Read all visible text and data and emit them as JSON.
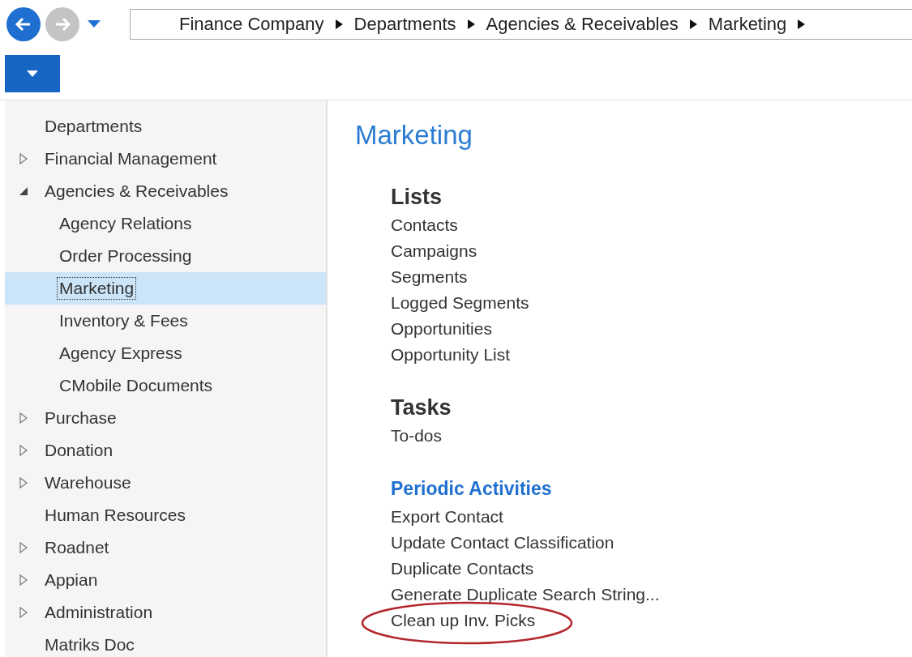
{
  "navigation": {
    "back_enabled": true,
    "forward_enabled": false
  },
  "breadcrumb": [
    "Finance Company",
    "Departments",
    "Agencies & Receivables",
    "Marketing"
  ],
  "sidebar": {
    "items": [
      {
        "label": "Departments",
        "expandable": false,
        "selected": false
      },
      {
        "label": "Financial Management",
        "expandable": true,
        "expanded": false,
        "selected": false
      },
      {
        "label": "Agencies & Receivables",
        "expandable": true,
        "expanded": true,
        "selected": false,
        "children": [
          {
            "label": "Agency Relations",
            "selected": false
          },
          {
            "label": "Order Processing",
            "selected": false
          },
          {
            "label": "Marketing",
            "selected": true
          },
          {
            "label": "Inventory & Fees",
            "selected": false
          },
          {
            "label": "Agency Express",
            "selected": false
          },
          {
            "label": "CMobile Documents",
            "selected": false
          }
        ]
      },
      {
        "label": "Purchase",
        "expandable": true,
        "expanded": false,
        "selected": false
      },
      {
        "label": "Donation",
        "expandable": true,
        "expanded": false,
        "selected": false
      },
      {
        "label": "Warehouse",
        "expandable": true,
        "expanded": false,
        "selected": false
      },
      {
        "label": "Human Resources",
        "expandable": false,
        "selected": false
      },
      {
        "label": "Roadnet",
        "expandable": true,
        "expanded": false,
        "selected": false
      },
      {
        "label": "Appian",
        "expandable": true,
        "expanded": false,
        "selected": false
      },
      {
        "label": "Administration",
        "expandable": true,
        "expanded": false,
        "selected": false
      },
      {
        "label": "Matriks Doc",
        "expandable": false,
        "selected": false
      }
    ]
  },
  "page": {
    "title": "Marketing",
    "sections": [
      {
        "heading": "Lists",
        "kind": "plain",
        "items": [
          {
            "label": "Contacts",
            "circled": false
          },
          {
            "label": "Campaigns",
            "circled": false
          },
          {
            "label": "Segments",
            "circled": false
          },
          {
            "label": "Logged Segments",
            "circled": false
          },
          {
            "label": "Opportunities",
            "circled": false
          },
          {
            "label": "Opportunity List",
            "circled": false
          }
        ]
      },
      {
        "heading": "Tasks",
        "kind": "plain",
        "items": [
          {
            "label": "To-dos",
            "circled": false
          }
        ]
      },
      {
        "heading": "Periodic Activities",
        "kind": "accent",
        "items": [
          {
            "label": "Export Contact",
            "circled": false
          },
          {
            "label": "Update Contact Classification",
            "circled": false
          },
          {
            "label": "Duplicate Contacts",
            "circled": false
          },
          {
            "label": "Generate Duplicate Search String...",
            "circled": false
          },
          {
            "label": "Clean up Inv. Picks",
            "circled": true
          }
        ]
      }
    ]
  }
}
